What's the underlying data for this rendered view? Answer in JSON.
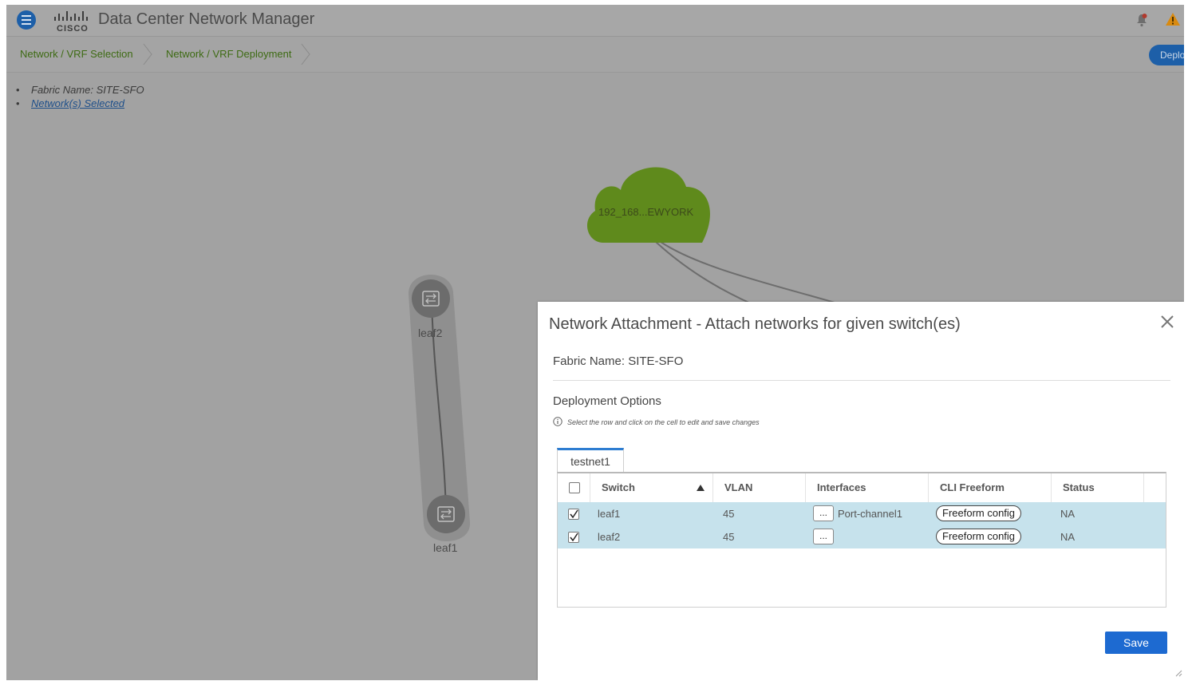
{
  "header": {
    "app_title": "Data Center Network Manager",
    "brand_logo": "cisco",
    "icons": [
      "menu-icon",
      "bell-icon",
      "warning-icon"
    ]
  },
  "breadcrumb": {
    "items": [
      {
        "label": "Network / VRF Selection"
      },
      {
        "label": "Network / VRF Deployment"
      }
    ],
    "deploy_label": "Deplo"
  },
  "info": {
    "fabric_name": "Fabric Name: SITE-SFO",
    "networks_link": "Network(s) Selected"
  },
  "topology": {
    "cloud_label": "192_168...EWYORK",
    "nodes": [
      {
        "label": "leaf2"
      },
      {
        "label": "leaf1"
      }
    ]
  },
  "modal": {
    "title": "Network Attachment - Attach networks for given switch(es)",
    "fabric_name": "Fabric Name: SITE-SFO",
    "deployment_title": "Deployment Options",
    "hint": "Select the row and click on the cell to edit and save changes",
    "tab_label": "testnet1",
    "columns": [
      "Switch",
      "VLAN",
      "Interfaces",
      "CLI Freeform",
      "Status"
    ],
    "dots_label": "...",
    "rows": [
      {
        "switch": "leaf1",
        "vlan": "45",
        "interfaces": "Port-channel1",
        "cli": "Freeform config",
        "status": "NA",
        "checked": true
      },
      {
        "switch": "leaf2",
        "vlan": "45",
        "interfaces": "",
        "cli": "Freeform config",
        "status": "NA",
        "checked": true
      }
    ],
    "save_label": "Save",
    "colors": {
      "accent": "#1d6ad1",
      "row_selected": "#c6e2ec",
      "cloud": "#5f8a1c"
    }
  }
}
